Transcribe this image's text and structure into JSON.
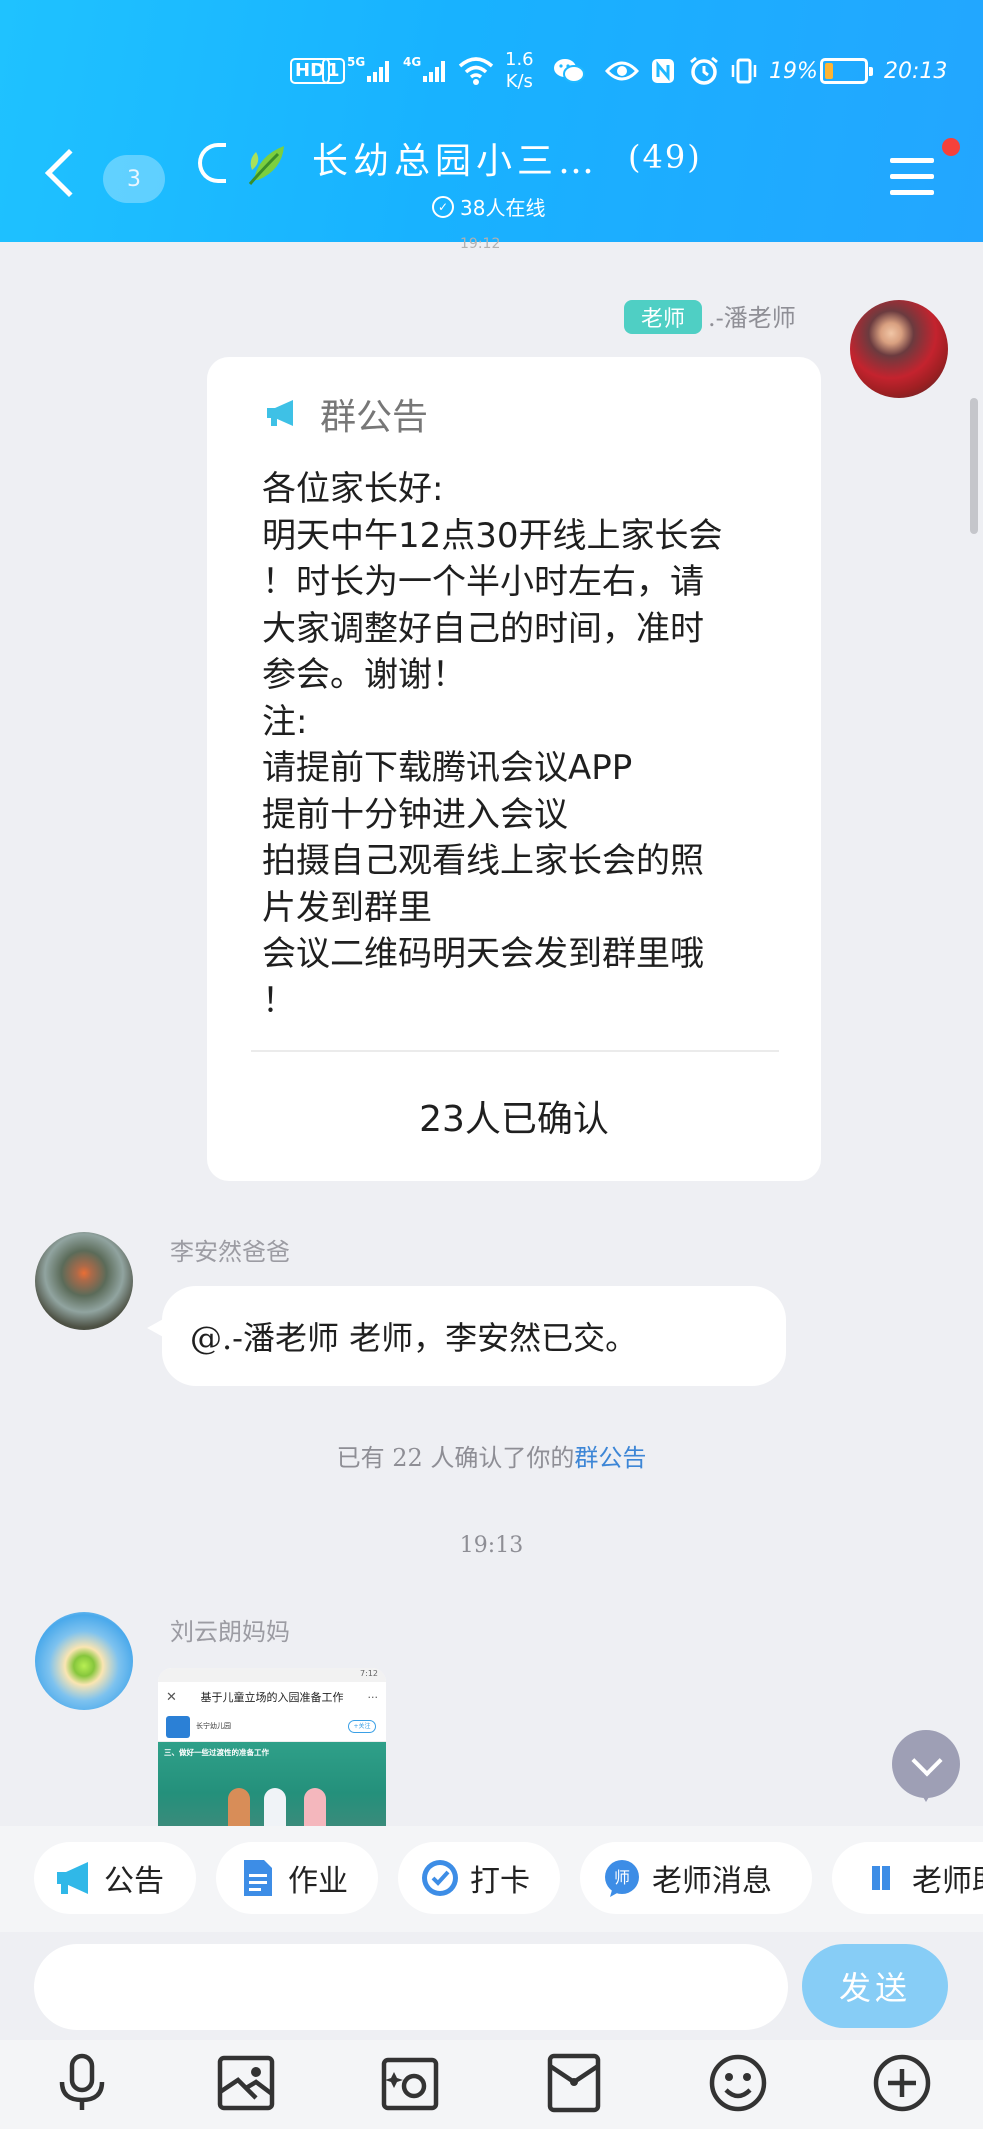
{
  "status_bar": {
    "hd": "HD",
    "sim": "1",
    "net1": "5G",
    "net2": "4G",
    "speed": "1.6",
    "speed_unit": "K/s",
    "battery": "19%",
    "battery_level": 0.19,
    "time": "20:13"
  },
  "header": {
    "unread": "3",
    "group_name": "长幼总园小三…",
    "member_count": "(49)",
    "online": "38人在线"
  },
  "messages": {
    "top_time": "19:12",
    "teacher": {
      "tag": "老师",
      "name": ".-潘老师"
    },
    "announcement": {
      "title": "群公告",
      "body": "各位家长好:\n明天中午12点30开线上家长会\n！时长为一个半小时左右，请\n大家调整好自己的时间，准时\n参会。谢谢！\n注:\n请提前下载腾讯会议APP\n提前十分钟进入会议\n拍摄自己观看线上家长会的照\n片发到群里\n会议二维码明天会发到群里哦\n！",
      "confirmed": "23人已确认"
    },
    "reply": {
      "sender": "李安然爸爸",
      "text": "@.-潘老师 老师，李安然已交。"
    },
    "system": {
      "prefix": "已有 22 人确认了你的",
      "link": "群公告"
    },
    "timestamp": "19:13",
    "image_msg": {
      "sender": "刘云朗妈妈",
      "thumb_title": "基于儿童立场的入园准备工作",
      "thumb_time": "7:12",
      "thumb_account": "长宁幼儿园",
      "thumb_follow": "+关注",
      "thumb_text": "三、做好一些过渡性的准备工作"
    }
  },
  "quick_actions": [
    "公告",
    "作业",
    "打卡",
    "老师消息",
    "老师助手"
  ],
  "composer": {
    "placeholder": "",
    "send": "发送"
  },
  "toolbar": [
    "voice-icon",
    "image-icon",
    "camera-icon",
    "red-packet-icon",
    "emoji-icon",
    "plus-icon"
  ],
  "colors": {
    "header": "#1fb8ff",
    "teacher_tag": "#4fcfc4",
    "link": "#3d86d6",
    "send_button": "#87cdf6"
  }
}
